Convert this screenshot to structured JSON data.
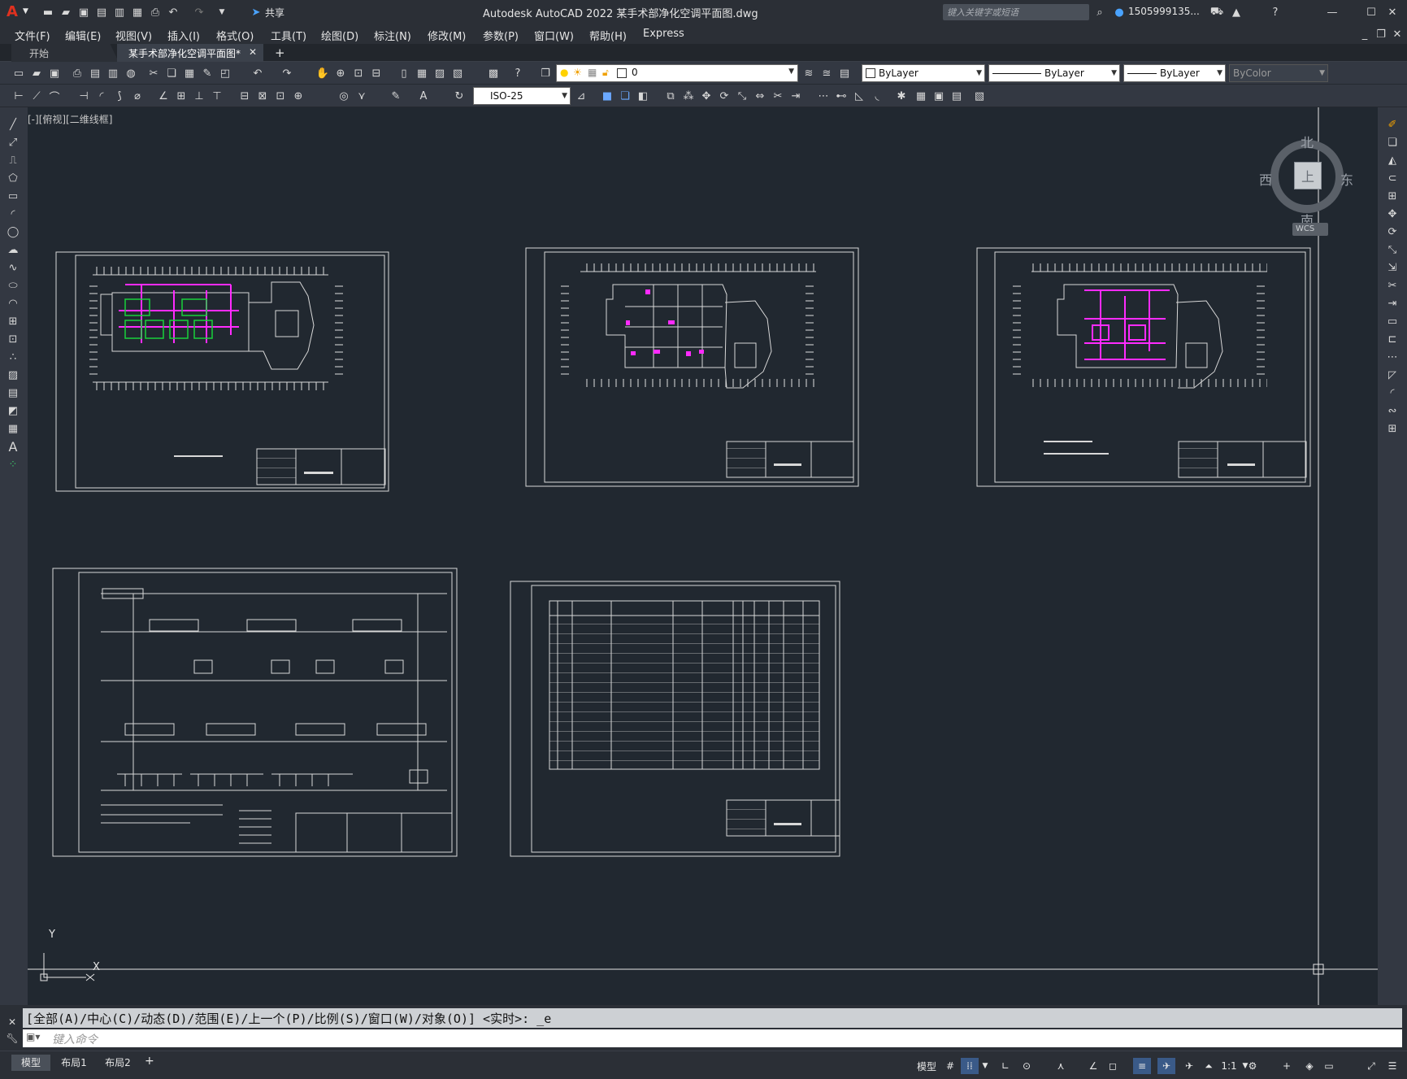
{
  "window": {
    "title": "Autodesk AutoCAD 2022    某手术部净化空调平面图.dwg",
    "search_placeholder": "键入关键字或短语",
    "user": "1505999135...",
    "share": "共享"
  },
  "menu": [
    "文件(F)",
    "编辑(E)",
    "视图(V)",
    "插入(I)",
    "格式(O)",
    "工具(T)",
    "绘图(D)",
    "标注(N)",
    "修改(M)",
    "参数(P)",
    "窗口(W)",
    "帮助(H)",
    "Express"
  ],
  "tabs": {
    "start": "开始",
    "file": "某手术部净化空调平面图*",
    "add": "+"
  },
  "toolbar": {
    "layer_value": "0",
    "color": "ByLayer",
    "linetype": "ByLayer",
    "lineweight": "ByLayer",
    "plotstyle": "ByColor",
    "dimstyle": "ISO-25"
  },
  "viewport": {
    "label": "[-][俯视][二维线框]"
  },
  "viewcube": {
    "north": "北",
    "south": "南",
    "east": "东",
    "west": "西",
    "top": "上",
    "wcs": "WCS"
  },
  "ucs": {
    "y": "Y",
    "x": "X"
  },
  "command": {
    "history": "[全部(A)/中心(C)/动态(D)/范围(E)/上一个(P)/比例(S)/窗口(W)/对象(O)] <实时>: _e",
    "placeholder": "键入命令"
  },
  "layouts": [
    "模型",
    "布局1",
    "布局2"
  ],
  "status": {
    "model": "模型",
    "scale": "1:1"
  },
  "colors": {
    "magenta": "#ff2bff",
    "green": "#19d13a",
    "background": "#212830"
  }
}
